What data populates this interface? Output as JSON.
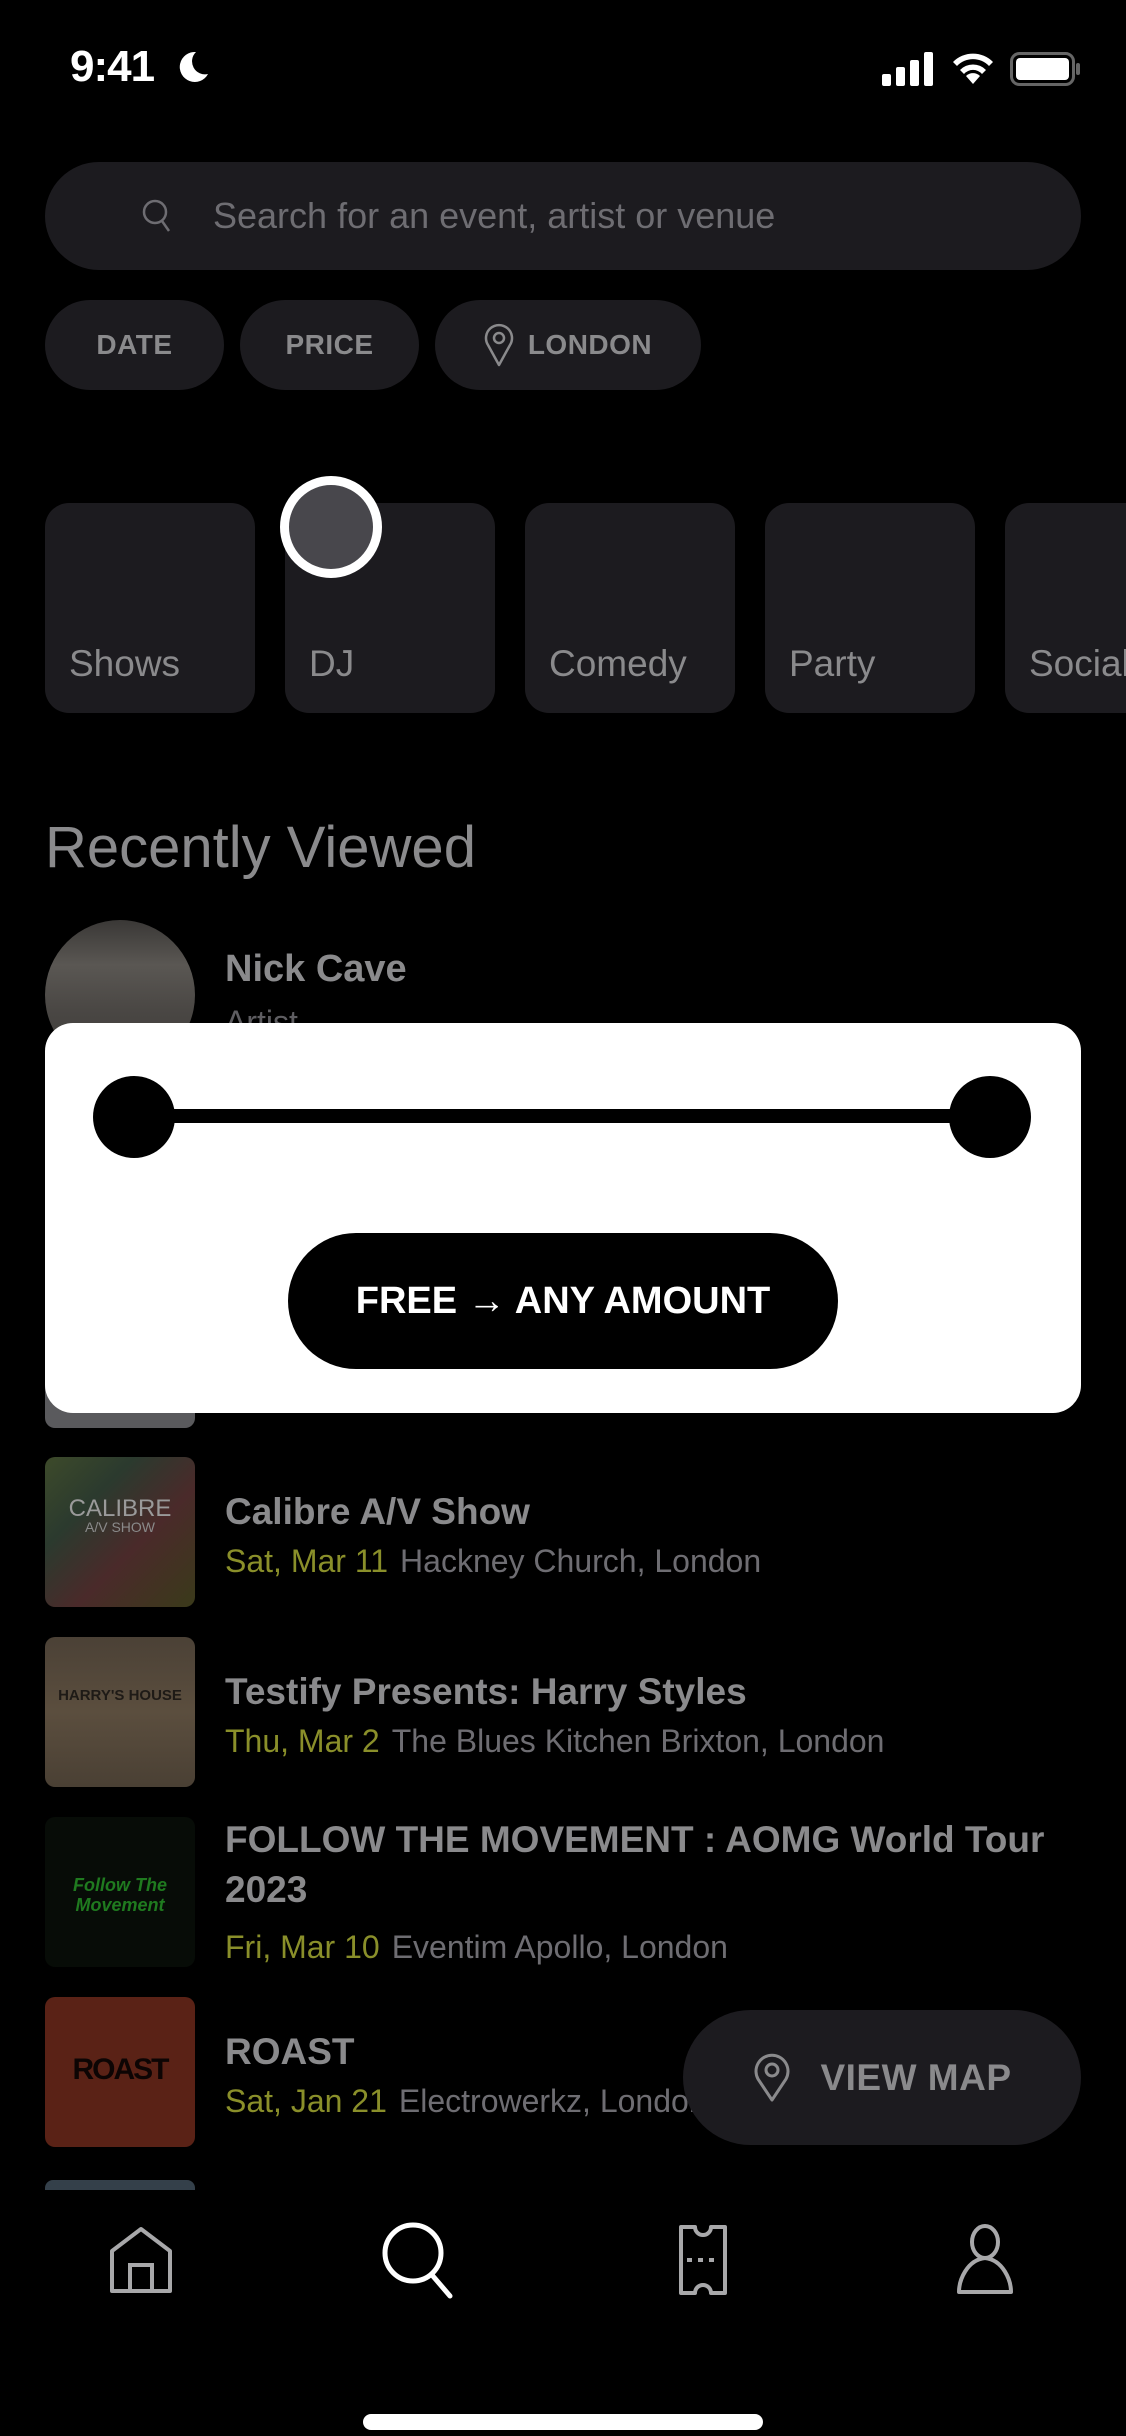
{
  "status_bar": {
    "time": "9:41"
  },
  "search": {
    "placeholder": "Search for an event, artist or venue",
    "value": ""
  },
  "filters": {
    "date_label": "DATE",
    "price_label": "PRICE",
    "location_label": "LONDON"
  },
  "categories": [
    {
      "label": "Shows"
    },
    {
      "label": "DJ"
    },
    {
      "label": "Comedy"
    },
    {
      "label": "Party"
    },
    {
      "label": "Social"
    }
  ],
  "recently_viewed": {
    "title": "Recently Viewed",
    "artist": {
      "name": "Nick Cave",
      "type": "Artist"
    }
  },
  "price_modal": {
    "range_min_fraction": 0,
    "range_max_fraction": 1,
    "button_label": "FREE → ANY AMOUNT"
  },
  "events": [
    {
      "title": "Calibre A/V Show",
      "date": "Sat, Mar 11",
      "venue": "Hackney Church, London",
      "thumb_text": "CALIBRE",
      "thumb_subtext": "A/V SHOW"
    },
    {
      "title": "Testify Presents: Harry Styles",
      "date": "Thu, Mar 2",
      "venue": "The Blues Kitchen Brixton, London",
      "thumb_text": "HARRY'S HOUSE"
    },
    {
      "title": "FOLLOW THE MOVEMENT : AOMG World Tour 2023",
      "date": "Fri, Mar 10",
      "venue": "Eventim Apollo, London",
      "thumb_text": "Follow The Movement"
    },
    {
      "title": "ROAST",
      "date": "Sat, Jan 21",
      "venue": "Electrowerkz, London",
      "thumb_text": "ROAST"
    }
  ],
  "view_map": {
    "label": "VIEW MAP"
  },
  "tab_bar": {
    "active": "search",
    "items": [
      "home",
      "search",
      "tickets",
      "profile"
    ]
  },
  "colors": {
    "background": "#000000",
    "surface": "#1c1b1f",
    "text_muted": "#8a8a8c",
    "date_accent": "#8a8f2a",
    "modal_background": "#ffffff"
  }
}
